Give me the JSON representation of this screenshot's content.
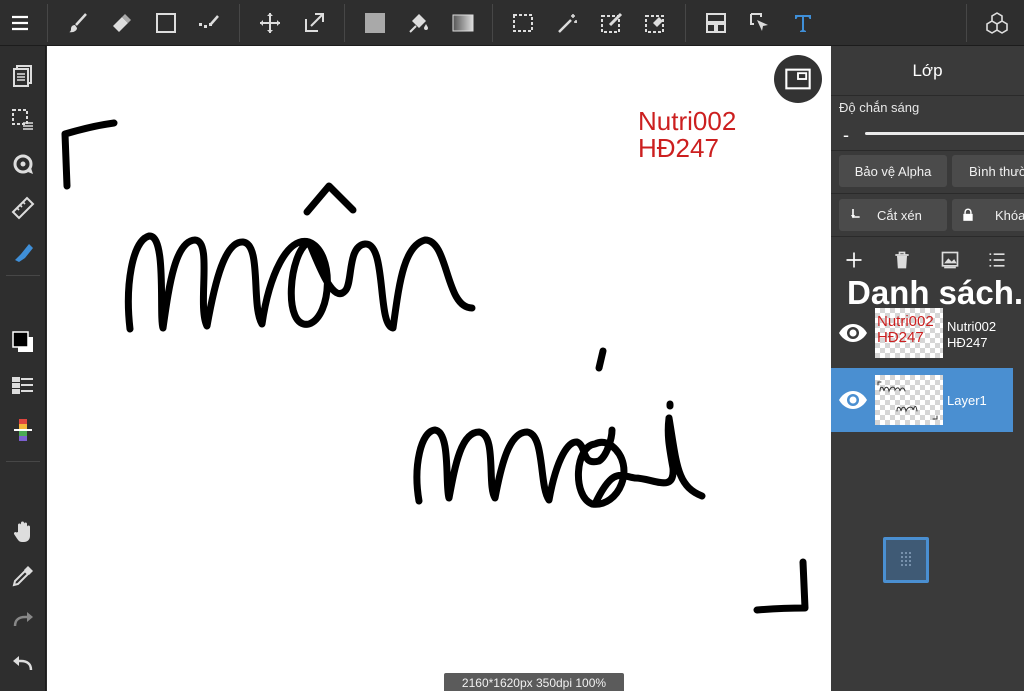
{
  "toolbar": {
    "top": [
      "menu-icon",
      "brush-icon",
      "eraser-icon",
      "rectangle-icon",
      "dot-icon",
      "move-icon",
      "transform-icon",
      "fill-color-icon",
      "bucket-icon",
      "gradient-icon",
      "selection-icon",
      "magic-wand-icon",
      "select-pen-icon",
      "select-eraser-icon",
      "layout-icon",
      "select-pointer-icon",
      "text-icon",
      "materials-icon"
    ],
    "left": [
      "pages-icon",
      "selection-ops-icon",
      "rotate-icon",
      "ruler-icon",
      "pen-icon",
      "color-swatch-icon",
      "layers-list-icon",
      "color-bar-icon",
      "hand-icon",
      "eyedropper-icon",
      "redo-icon",
      "undo-icon"
    ]
  },
  "canvas": {
    "text_line1": "Nutri002",
    "text_line2": "HĐ247",
    "text_color": "#cc1f1f",
    "status": "2160*1620px 350dpi 100%"
  },
  "panel": {
    "title": "Lớp",
    "opacity_label": "Độ chắn sáng",
    "opacity_minus": "-",
    "alpha_protect": "Bảo vệ Alpha",
    "blend_mode": "Bình thường",
    "clipping": "Cắt xén",
    "lock": "Khóa",
    "list_title": "Danh sách.",
    "layers": [
      {
        "name_line1": "Nutri002",
        "name_line2": "HĐ247",
        "visible": true,
        "selected": false
      },
      {
        "name": "Layer1",
        "visible": true,
        "selected": true
      }
    ]
  },
  "colors": {
    "accent": "#4a8fd1",
    "panel_bg": "#3a3a3a",
    "toolbar_bg": "#2e2e2e",
    "text_red": "#cc1f1f"
  }
}
